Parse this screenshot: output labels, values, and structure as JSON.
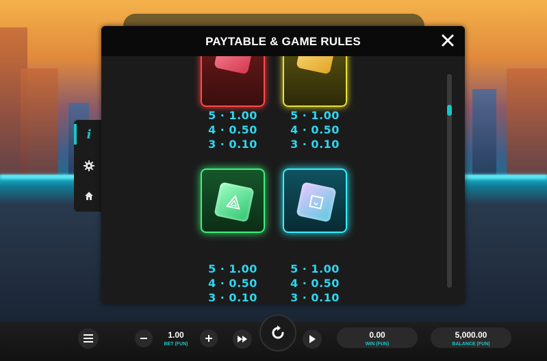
{
  "modal": {
    "title": "PAYTABLE & GAME RULES",
    "close_icon": "close-icon"
  },
  "paytable": [
    {
      "symbol": "red-gem",
      "color": "#ff4a4a",
      "pays": [
        "5 · 1.00",
        "4 · 0.50",
        "3 · 0.10"
      ]
    },
    {
      "symbol": "yellow-gem",
      "color": "#e8e23a",
      "pays": [
        "5 · 1.00",
        "4 · 0.50",
        "3 · 0.10"
      ]
    },
    {
      "symbol": "green-triangle-gem",
      "color": "#42f07a",
      "pays": [
        "5 · 1.00",
        "4 · 0.50",
        "3 · 0.10"
      ]
    },
    {
      "symbol": "cyan-square-gem",
      "color": "#36f0ff",
      "pays": [
        "5 · 1.00",
        "4 · 0.50",
        "3 · 0.10"
      ]
    }
  ],
  "side_menu": {
    "items": [
      {
        "name": "info",
        "icon": "info-icon",
        "active": true
      },
      {
        "name": "settings",
        "icon": "gear-icon"
      },
      {
        "name": "home",
        "icon": "home-icon"
      }
    ]
  },
  "bottom_bar": {
    "menu_icon": "hamburger-icon",
    "bet": {
      "value": "1.00",
      "label": "BET (FUN)"
    },
    "win": {
      "value": "0.00",
      "label": "WIN (FUN)"
    },
    "balance": {
      "value": "5,000.00",
      "label": "BALANCE (FUN)"
    },
    "accent_color": "#19c6c6"
  }
}
